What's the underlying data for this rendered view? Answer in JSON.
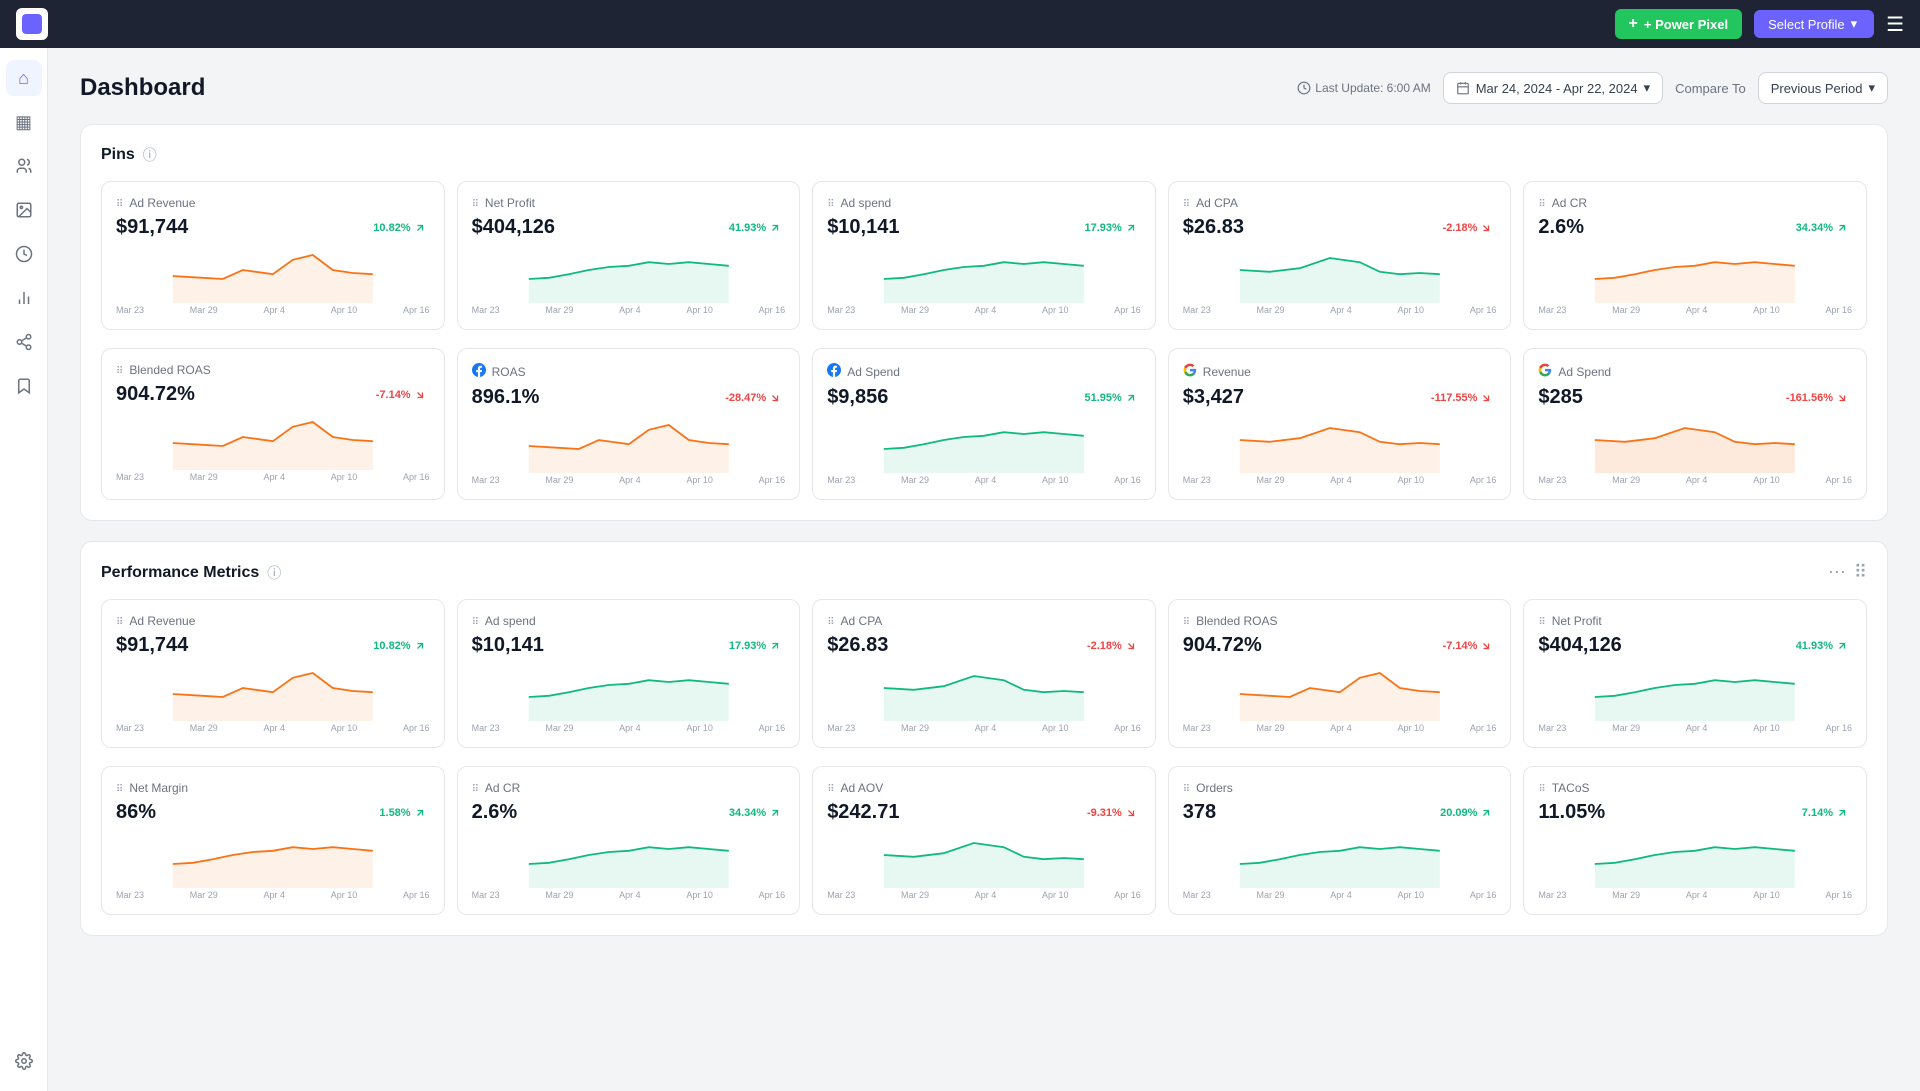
{
  "topbar": {
    "power_pixel_label": "+ Power Pixel",
    "dropdown_label": "Select Profile",
    "hamburger": "☰"
  },
  "sidebar": {
    "items": [
      {
        "name": "home",
        "icon": "⌂",
        "active": true
      },
      {
        "name": "chart-bar",
        "icon": "▦"
      },
      {
        "name": "users",
        "icon": "👤"
      },
      {
        "name": "image",
        "icon": "🖼"
      },
      {
        "name": "dollar",
        "icon": "$"
      },
      {
        "name": "chart-line",
        "icon": "📈"
      },
      {
        "name": "share",
        "icon": "↗"
      },
      {
        "name": "bookmark",
        "icon": "🔖"
      },
      {
        "name": "settings",
        "icon": "⚙"
      }
    ]
  },
  "header": {
    "title": "Dashboard",
    "last_update": "Last Update: 6:00 AM",
    "date_range": "Mar 24, 2024 - Apr 22, 2024",
    "compare_to": "Compare To",
    "compare_period": "Previous Period"
  },
  "pins_section": {
    "title": "Pins",
    "cards": [
      {
        "label": "Ad Revenue",
        "value": "$91,744",
        "change": "10.82%",
        "positive": true,
        "color_line": "#f97316",
        "color_fill": "rgba(249,115,22,0.1)",
        "dates": [
          "Mar 23",
          "Mar 29",
          "Apr 4",
          "Apr 10",
          "Apr 16"
        ]
      },
      {
        "label": "Net Profit",
        "value": "$404,126",
        "change": "41.93%",
        "positive": true,
        "color_line": "#10b981",
        "color_fill": "rgba(16,185,129,0.1)",
        "dates": [
          "Mar 23",
          "Mar 29",
          "Apr 4",
          "Apr 10",
          "Apr 16"
        ]
      },
      {
        "label": "Ad spend",
        "value": "$10,141",
        "change": "17.93%",
        "positive": true,
        "color_line": "#10b981",
        "color_fill": "rgba(16,185,129,0.1)",
        "dates": [
          "Mar 23",
          "Mar 29",
          "Apr 4",
          "Apr 10",
          "Apr 16"
        ]
      },
      {
        "label": "Ad CPA",
        "value": "$26.83",
        "change": "-2.18%",
        "positive": false,
        "color_line": "#10b981",
        "color_fill": "rgba(16,185,129,0.1)",
        "dates": [
          "Mar 23",
          "Mar 29",
          "Apr 4",
          "Apr 10",
          "Apr 16"
        ]
      },
      {
        "label": "Ad CR",
        "value": "2.6%",
        "change": "34.34%",
        "positive": true,
        "color_line": "#f97316",
        "color_fill": "rgba(249,115,22,0.1)",
        "dates": [
          "Mar 23",
          "Mar 29",
          "Apr 4",
          "Apr 10",
          "Apr 16"
        ]
      }
    ],
    "cards2": [
      {
        "label": "Blended ROAS",
        "value": "904.72%",
        "change": "-7.14%",
        "positive": false,
        "color_line": "#f97316",
        "color_fill": "rgba(249,115,22,0.1)",
        "icon": "dots",
        "dates": [
          "Mar 23",
          "Mar 29",
          "Apr 4",
          "Apr 10",
          "Apr 16"
        ]
      },
      {
        "label": "ROAS",
        "value": "896.1%",
        "change": "-28.47%",
        "positive": false,
        "color_line": "#f97316",
        "color_fill": "rgba(249,115,22,0.1)",
        "icon": "fb",
        "dates": [
          "Mar 23",
          "Mar 29",
          "Apr 4",
          "Apr 10",
          "Apr 16"
        ]
      },
      {
        "label": "Ad Spend",
        "value": "$9,856",
        "change": "51.95%",
        "positive": true,
        "color_line": "#10b981",
        "color_fill": "rgba(16,185,129,0.1)",
        "icon": "fb",
        "dates": [
          "Mar 23",
          "Mar 29",
          "Apr 4",
          "Apr 10",
          "Apr 16"
        ]
      },
      {
        "label": "Revenue",
        "value": "$3,427",
        "change": "-117.55%",
        "positive": false,
        "color_line": "#f97316",
        "color_fill": "rgba(249,115,22,0.1)",
        "icon": "google",
        "dates": [
          "Mar 23",
          "Mar 29",
          "Apr 4",
          "Apr 10",
          "Apr 16"
        ]
      },
      {
        "label": "Ad Spend",
        "value": "$285",
        "change": "-161.56%",
        "positive": false,
        "color_line": "#f97316",
        "color_fill": "rgba(249,115,22,0.15)",
        "icon": "google",
        "dates": [
          "Mar 23",
          "Mar 29",
          "Apr 4",
          "Apr 10",
          "Apr 16"
        ]
      }
    ]
  },
  "performance_section": {
    "title": "Performance Metrics",
    "cards": [
      {
        "label": "Ad Revenue",
        "value": "$91,744",
        "change": "10.82%",
        "positive": true,
        "color_line": "#f97316",
        "color_fill": "rgba(249,115,22,0.1)",
        "dates": [
          "Mar 23",
          "Mar 29",
          "Apr 4",
          "Apr 10",
          "Apr 16"
        ]
      },
      {
        "label": "Ad spend",
        "value": "$10,141",
        "change": "17.93%",
        "positive": true,
        "color_line": "#10b981",
        "color_fill": "rgba(16,185,129,0.1)",
        "dates": [
          "Mar 23",
          "Mar 29",
          "Apr 4",
          "Apr 10",
          "Apr 16"
        ]
      },
      {
        "label": "Ad CPA",
        "value": "$26.83",
        "change": "-2.18%",
        "positive": false,
        "color_line": "#10b981",
        "color_fill": "rgba(16,185,129,0.1)",
        "dates": [
          "Mar 23",
          "Mar 29",
          "Apr 4",
          "Apr 10",
          "Apr 16"
        ]
      },
      {
        "label": "Blended ROAS",
        "value": "904.72%",
        "change": "-7.14%",
        "positive": false,
        "color_line": "#f97316",
        "color_fill": "rgba(249,115,22,0.1)",
        "dates": [
          "Mar 23",
          "Mar 29",
          "Apr 4",
          "Apr 10",
          "Apr 16"
        ]
      },
      {
        "label": "Net Profit",
        "value": "$404,126",
        "change": "41.93%",
        "positive": true,
        "color_line": "#10b981",
        "color_fill": "rgba(16,185,129,0.1)",
        "dates": [
          "Mar 23",
          "Mar 29",
          "Apr 4",
          "Apr 10",
          "Apr 16"
        ]
      }
    ],
    "cards2": [
      {
        "label": "Net Margin",
        "value": "86%",
        "change": "1.58%",
        "positive": true,
        "color_line": "#f97316",
        "color_fill": "rgba(249,115,22,0.1)",
        "dates": [
          "Mar 23",
          "Mar 29",
          "Apr 4",
          "Apr 10",
          "Apr 16"
        ]
      },
      {
        "label": "Ad CR",
        "value": "2.6%",
        "change": "34.34%",
        "positive": true,
        "color_line": "#10b981",
        "color_fill": "rgba(16,185,129,0.1)",
        "dates": [
          "Mar 23",
          "Mar 29",
          "Apr 4",
          "Apr 10",
          "Apr 16"
        ]
      },
      {
        "label": "Ad AOV",
        "value": "$242.71",
        "change": "-9.31%",
        "positive": false,
        "color_line": "#10b981",
        "color_fill": "rgba(16,185,129,0.1)",
        "dates": [
          "Mar 23",
          "Mar 29",
          "Apr 4",
          "Apr 10",
          "Apr 16"
        ]
      },
      {
        "label": "Orders",
        "value": "378",
        "change": "20.09%",
        "positive": true,
        "color_line": "#10b981",
        "color_fill": "rgba(16,185,129,0.1)",
        "dates": [
          "Mar 23",
          "Mar 29",
          "Apr 4",
          "Apr 10",
          "Apr 16"
        ]
      },
      {
        "label": "TACoS",
        "value": "11.05%",
        "change": "7.14%",
        "positive": true,
        "color_line": "#10b981",
        "color_fill": "rgba(16,185,129,0.1)",
        "dates": [
          "Mar 23",
          "Mar 29",
          "Apr 4",
          "Apr 10",
          "Apr 16"
        ]
      }
    ]
  },
  "sparklines": {
    "orange_up": [
      [
        0,
        45
      ],
      [
        10,
        42
      ],
      [
        20,
        40
      ],
      [
        30,
        48
      ],
      [
        40,
        35
      ],
      [
        50,
        60
      ],
      [
        60,
        75
      ],
      [
        70,
        50
      ],
      [
        80,
        45
      ],
      [
        90,
        42
      ],
      [
        100,
        44
      ]
    ],
    "green_up": [
      [
        0,
        50
      ],
      [
        10,
        48
      ],
      [
        20,
        52
      ],
      [
        30,
        55
      ],
      [
        40,
        58
      ],
      [
        50,
        65
      ],
      [
        60,
        70
      ],
      [
        70,
        65
      ],
      [
        80,
        68
      ],
      [
        90,
        65
      ],
      [
        100,
        62
      ]
    ],
    "orange_down": [
      [
        0,
        65
      ],
      [
        10,
        60
      ],
      [
        20,
        55
      ],
      [
        30,
        60
      ],
      [
        40,
        70
      ],
      [
        50,
        65
      ],
      [
        60,
        50
      ],
      [
        70,
        45
      ],
      [
        80,
        55
      ],
      [
        90,
        52
      ],
      [
        100,
        50
      ]
    ],
    "green_spike": [
      [
        0,
        48
      ],
      [
        10,
        46
      ],
      [
        20,
        44
      ],
      [
        30,
        50
      ],
      [
        40,
        48
      ],
      [
        50,
        55
      ],
      [
        60,
        65
      ],
      [
        70,
        58
      ],
      [
        80,
        52
      ],
      [
        90,
        50
      ],
      [
        100,
        48
      ]
    ]
  }
}
